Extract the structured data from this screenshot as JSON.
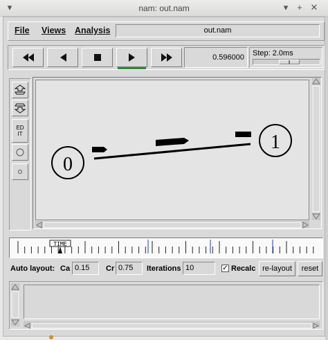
{
  "window": {
    "title": "nam: out.nam",
    "controls": [
      "▾",
      "+",
      "✕"
    ],
    "title_controls_left": "▾"
  },
  "menubar": {
    "file": "File",
    "views": "Views",
    "analysis": "Analysis",
    "filename": "out.nam"
  },
  "playback": {
    "buttons": [
      "fast-rewind",
      "rewind",
      "stop",
      "play",
      "fast-forward"
    ],
    "active_button": "play",
    "time": "0.596000",
    "step_label": "Step: 2.0ms",
    "step_slider_fraction": 0.45
  },
  "tools": {
    "edit_label_1": "ED",
    "edit_label_2": "IT"
  },
  "network": {
    "node0": "0",
    "node1": "1"
  },
  "timeline": {
    "marker_label": "TIME"
  },
  "autolayout": {
    "label": "Auto layout:",
    "ca_label": "Ca",
    "ca_value": "0.15",
    "cr_label": "Cr",
    "cr_value": "0.75",
    "iterations_label": "Iterations",
    "iterations_value": "10",
    "recalc_label": "Recalc",
    "recalc_checked": true,
    "relayout_label": "re-layout",
    "reset_label": "reset"
  },
  "colors": {
    "active_indicator": "#2c8a3c",
    "timeline_blue": "#1f3fbf"
  }
}
